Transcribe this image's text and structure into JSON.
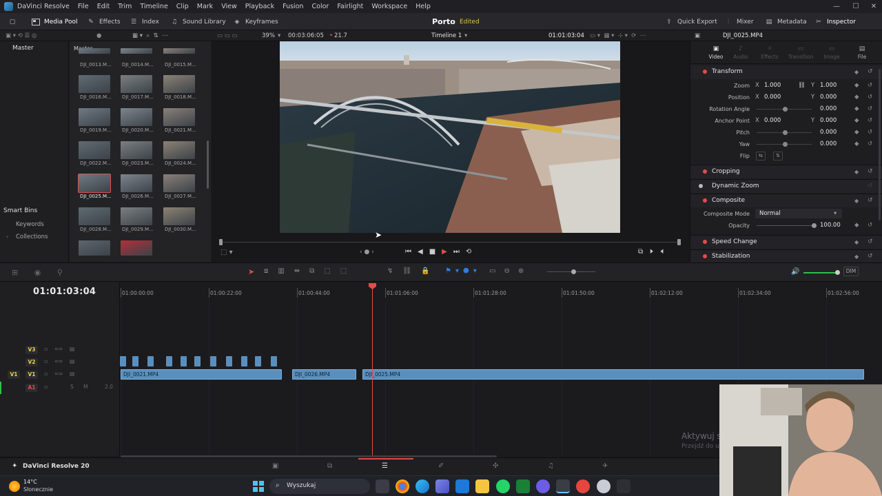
{
  "menu": {
    "app": "DaVinci Resolve",
    "items": [
      "File",
      "Edit",
      "Trim",
      "Timeline",
      "Clip",
      "Mark",
      "View",
      "Playback",
      "Fusion",
      "Color",
      "Fairlight",
      "Workspace",
      "Help"
    ]
  },
  "toolbar": {
    "media_pool": "Media Pool",
    "effects": "Effects",
    "index": "Index",
    "sound_library": "Sound Library",
    "keyframes": "Keyframes",
    "project": "Porto",
    "status": "Edited",
    "quick_export": "Quick Export",
    "mixer": "Mixer",
    "metadata": "Metadata",
    "inspector": "Inspector"
  },
  "subbar": {
    "zoom": "39%",
    "duration": "00:03:06:05",
    "fps": "21.7",
    "timeline_name": "Timeline 1",
    "timecode": "01:01:03:04",
    "clip_name": "DJI_0025.MP4"
  },
  "bins": {
    "master": "Master",
    "smart_bins": "Smart Bins",
    "keywords": "Keywords",
    "collections": "Collections"
  },
  "pool": {
    "header": "Master",
    "clips": [
      "DJI_0013.M...",
      "DJI_0014.M...",
      "DJI_0015.M...",
      "DJI_0016.M...",
      "DJI_0017.M...",
      "DJI_0018.M...",
      "DJI_0019.M...",
      "DJI_0020.M...",
      "DJI_0021.M...",
      "DJI_0022.M...",
      "DJI_0023.M...",
      "DJI_0024.M...",
      "DJI_0025.M...",
      "DJI_0026.M...",
      "DJI_0027.M...",
      "DJI_0028.M...",
      "DJI_0029.M...",
      "DJI_0030.M..."
    ],
    "selected_index": 12
  },
  "inspector": {
    "tabs": [
      "Video",
      "Audio",
      "Effects",
      "Transition",
      "Image",
      "File"
    ],
    "transform": "Transform",
    "zoom_label": "Zoom",
    "position_label": "Position",
    "rotation_label": "Rotation Angle",
    "anchor_label": "Anchor Point",
    "pitch_label": "Pitch",
    "yaw_label": "Yaw",
    "flip_label": "Flip",
    "x": "X",
    "y": "Y",
    "zoom_x": "1.000",
    "zoom_y": "1.000",
    "pos_x": "0.000",
    "pos_y": "0.000",
    "rotation": "0.000",
    "anchor_x": "0.000",
    "anchor_y": "0.000",
    "pitch": "0.000",
    "yaw": "0.000",
    "cropping": "Cropping",
    "dynamic_zoom": "Dynamic Zoom",
    "composite": "Composite",
    "composite_mode_label": "Composite Mode",
    "composite_mode": "Normal",
    "opacity_label": "Opacity",
    "opacity": "100.00",
    "speed_change": "Speed Change",
    "stabilization": "Stabilization"
  },
  "timeline": {
    "timecode": "01:01:03:04",
    "ruler": [
      "01:00:00:00",
      "01:00:22:00",
      "01:00:44:00",
      "01:01:06:00",
      "01:01:28:00",
      "01:01:50:00",
      "01:02:12:00",
      "01:02:34:00",
      "01:02:56:00"
    ],
    "tracks": [
      "V3",
      "V2",
      "V1",
      "A1"
    ],
    "v1_dest": "V1",
    "a1_level": "2.0",
    "a1_s": "S",
    "a1_m": "M",
    "clips": [
      "DJI_0021.MP4",
      "DJI_0026.MP4",
      "DJI_0025.MP4"
    ],
    "dim": "DIM"
  },
  "watermark": {
    "line1": "Aktywuj s",
    "line2": "Przejdź do u"
  },
  "pagebar": {
    "app_label": "DaVinci Resolve 20"
  },
  "taskbar": {
    "temp": "14°C",
    "weather": "Słonecznie",
    "search": "Wyszukaj"
  },
  "colors": {
    "accent_red": "#e64b4b",
    "clip_blue": "#5a8fbd",
    "edited_yellow": "#e3c14a",
    "volume_green": "#2fbf4a"
  }
}
